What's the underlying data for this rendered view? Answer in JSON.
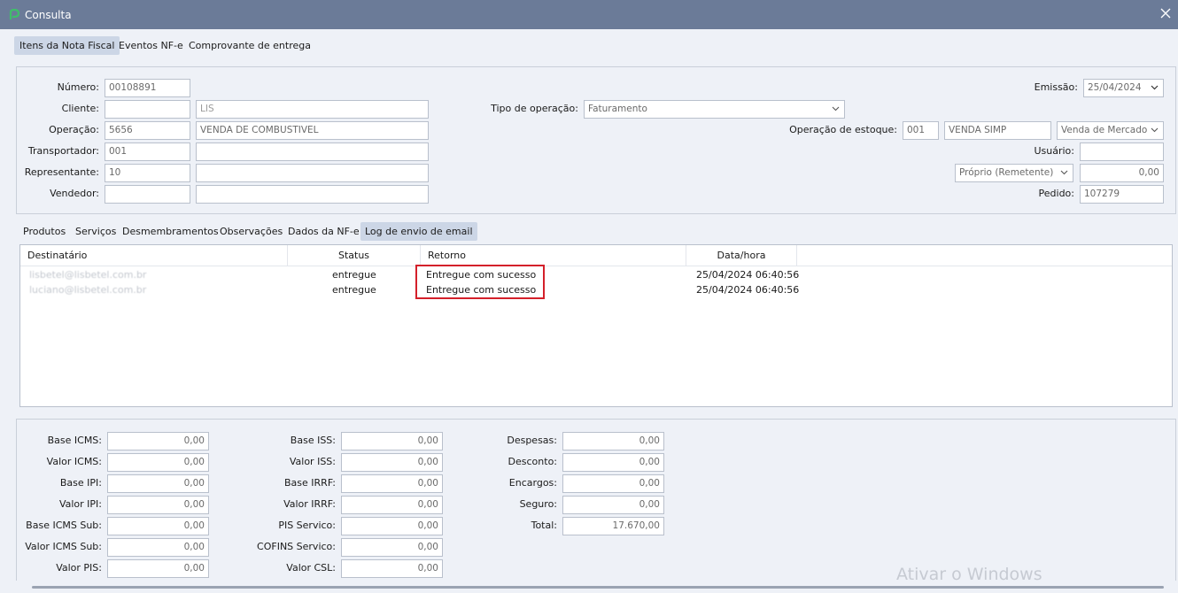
{
  "window": {
    "title": "Consulta"
  },
  "tabs": [
    "Itens da Nota Fiscal",
    "Eventos NF-e",
    "Comprovante de entrega"
  ],
  "header": {
    "numero": {
      "label": "Número:",
      "value": "00108891"
    },
    "cliente": {
      "label": "Cliente:",
      "code": "",
      "name": "LIS"
    },
    "operacao": {
      "label": "Operação:",
      "code": "5656",
      "name": "VENDA DE COMBUSTIVEL"
    },
    "transportador": {
      "label": "Transportador:",
      "code": "001",
      "name": ""
    },
    "representante": {
      "label": "Representante:",
      "code": "10",
      "name": ""
    },
    "vendedor": {
      "label": "Vendedor:",
      "code": "",
      "name": ""
    },
    "tipo_operacao": {
      "label": "Tipo de operação:",
      "value": "Faturamento"
    },
    "emissao": {
      "label": "Emissão:",
      "value": "25/04/2024"
    },
    "operacao_estoque": {
      "label": "Operação de estoque:",
      "code": "001",
      "name": "VENDA SIMP",
      "type": "Venda de Mercado"
    },
    "usuario": {
      "label": "Usuário:",
      "value": ""
    },
    "proprio": {
      "value": "Próprio (Remetente)",
      "amount": "0,00"
    },
    "pedido": {
      "label": "Pedido:",
      "value": "107279"
    }
  },
  "subtabs": [
    "Produtos",
    "Serviços",
    "Desmembramentos",
    "Observações",
    "Dados da NF-e",
    "Log de envio de email"
  ],
  "email_log": {
    "columns": [
      "Destinatário",
      "Status",
      "Retorno",
      "Data/hora"
    ],
    "rows": [
      {
        "destinatario": "lisbetel@lisbetel.com.br",
        "status": "entregue",
        "retorno": "Entregue com sucesso",
        "data_hora": "25/04/2024 06:40:56"
      },
      {
        "destinatario": "luciano@lisbetel.com.br",
        "status": "entregue",
        "retorno": "Entregue com sucesso",
        "data_hora": "25/04/2024 06:40:56"
      }
    ]
  },
  "totals": {
    "col1": [
      {
        "label": "Base ICMS:",
        "value": "0,00"
      },
      {
        "label": "Valor ICMS:",
        "value": "0,00"
      },
      {
        "label": "Base IPI:",
        "value": "0,00"
      },
      {
        "label": "Valor IPI:",
        "value": "0,00"
      },
      {
        "label": "Base ICMS Sub:",
        "value": "0,00"
      },
      {
        "label": "Valor ICMS Sub:",
        "value": "0,00"
      },
      {
        "label": "Valor PIS:",
        "value": "0,00"
      }
    ],
    "col2": [
      {
        "label": "Base ISS:",
        "value": "0,00"
      },
      {
        "label": "Valor ISS:",
        "value": "0,00"
      },
      {
        "label": "Base IRRF:",
        "value": "0,00"
      },
      {
        "label": "Valor IRRF:",
        "value": "0,00"
      },
      {
        "label": "PIS Servico:",
        "value": "0,00"
      },
      {
        "label": "COFINS Servico:",
        "value": "0,00"
      },
      {
        "label": "Valor CSL:",
        "value": "0,00"
      }
    ],
    "col3": [
      {
        "label": "Despesas:",
        "value": "0,00"
      },
      {
        "label": "Desconto:",
        "value": "0,00"
      },
      {
        "label": "Encargos:",
        "value": "0,00"
      },
      {
        "label": "Seguro:",
        "value": "0,00"
      },
      {
        "label": "Total:",
        "value": "17.670,00"
      }
    ]
  },
  "watermark": "Ativar o Windows",
  "colors": {
    "titlebar": "#6b7b98",
    "active_tab": "#ccd6e6",
    "highlight": "#d4202a",
    "background": "#eef1f7"
  }
}
